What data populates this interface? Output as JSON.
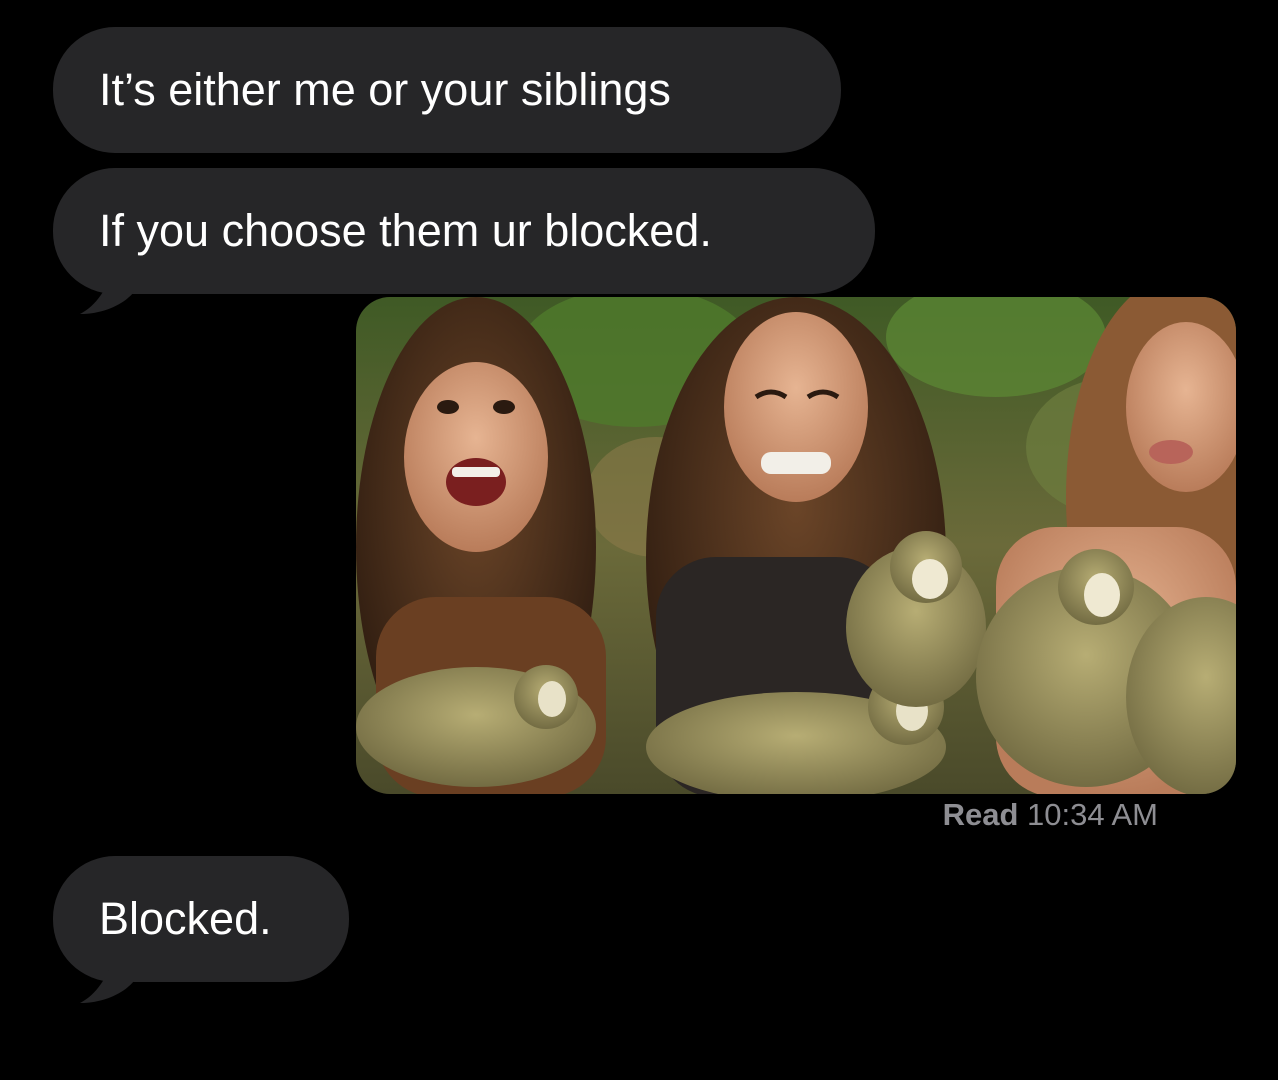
{
  "conversation": {
    "messages": [
      {
        "text": "It’s either me or your siblings"
      },
      {
        "text": "If you choose them ur blocked."
      },
      {
        "text": "Blocked."
      }
    ],
    "photo": {
      "icon": "photo-attachment",
      "colors": {
        "foliage": "#4f6a2e",
        "hair": "#4a2e1c",
        "skin": "#d8a27f",
        "monkey": "#9a9460"
      }
    },
    "receipt": {
      "read_label": "Read",
      "time": "10:34 AM"
    }
  },
  "theme": {
    "background": "#000000",
    "bubble_received": "#262628",
    "text": "#ffffff",
    "receipt_text": "#8e8e93"
  }
}
